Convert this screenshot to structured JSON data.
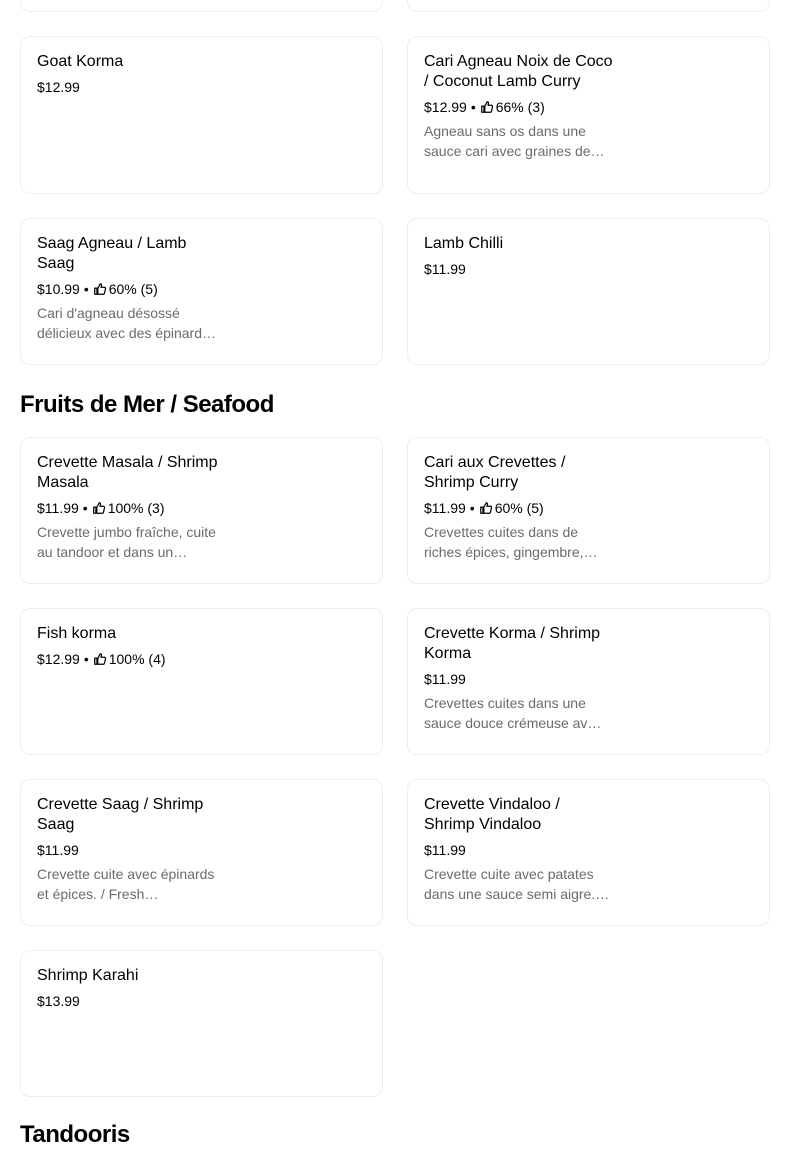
{
  "sections": {
    "seafood_title": "Fruits de Mer / Seafood",
    "tandoori_title": "Tandooris"
  },
  "items": {
    "goat_korma": {
      "name": "Goat Korma",
      "price": "$12.99"
    },
    "coconut_lamb": {
      "name": "Cari Agneau Noix de Coco / Coconut Lamb Curry",
      "price": "$12.99",
      "rating": "66% (3)",
      "desc": "Agneau sans os dans une sauce cari avec graines de…"
    },
    "saag_agneau": {
      "name": "Saag Agneau / Lamb Saag",
      "price": "$10.99",
      "rating": "60% (5)",
      "desc": "Cari d'agneau désossé délicieux avec des épinard…"
    },
    "lamb_chilli": {
      "name": "Lamb Chilli",
      "price": "$11.99"
    },
    "crevette_masala": {
      "name": "Crevette Masala / Shrimp Masala",
      "price": "$11.99",
      "rating": "100% (3)",
      "desc": "Crevette jumbo fraîche, cuite au tandoor et dans un…"
    },
    "cari_crevettes": {
      "name": "Cari aux Crevettes / Shrimp Curry",
      "price": "$11.99",
      "rating": "60% (5)",
      "desc": "Crevettes cuites dans de riches épices, gingembre,…"
    },
    "fish_korma": {
      "name": "Fish korma",
      "price": "$12.99",
      "rating": "100% (4)"
    },
    "crevette_korma": {
      "name": "Crevette Korma / Shrimp Korma",
      "price": "$11.99",
      "desc": "Crevettes cuites dans une sauce douce crémeuse av…"
    },
    "crevette_saag": {
      "name": "Crevette Saag / Shrimp Saag",
      "price": "$11.99",
      "desc": "Crevette cuite avec épinards et épices. / Fresh…"
    },
    "crevette_vindaloo": {
      "name": "Crevette Vindaloo / Shrimp Vindaloo",
      "price": "$11.99",
      "desc": "Crevette cuite avec patates dans une sauce semi aigre.…"
    },
    "shrimp_karahi": {
      "name": "Shrimp Karahi",
      "price": "$13.99"
    }
  },
  "icons": {
    "rating": "thumbs-up-icon"
  },
  "meta_separator": "•"
}
